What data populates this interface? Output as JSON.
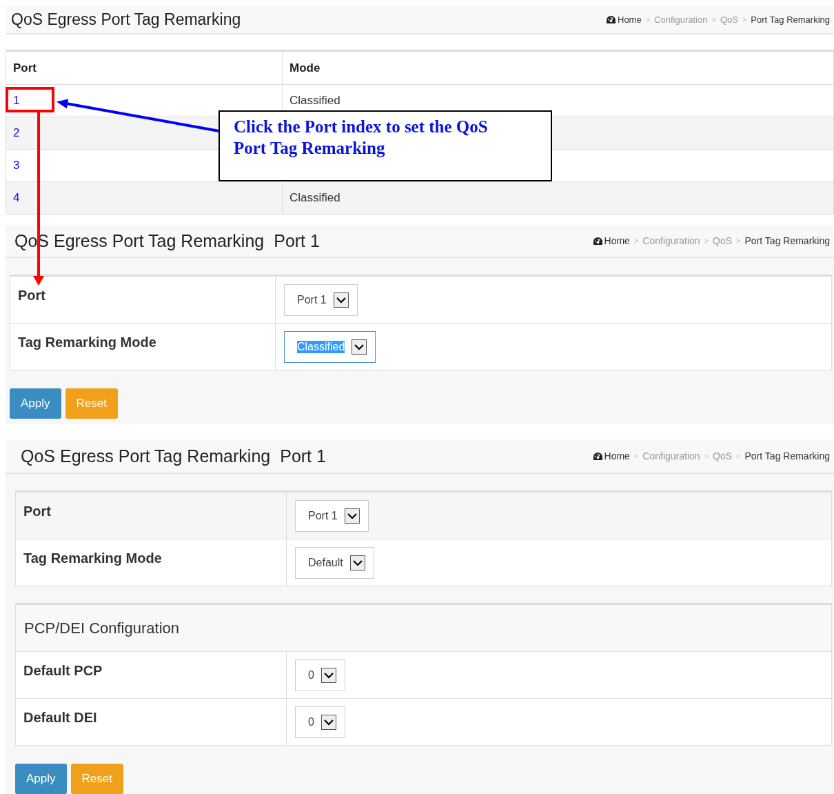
{
  "panels": [
    {
      "kind": "list",
      "title": "QoS Egress Port Tag Remarking",
      "breadcrumb": [
        {
          "kind": "home",
          "label": "Home"
        },
        {
          "kind": "link",
          "label": "Configuration",
          "separator": ">"
        },
        {
          "kind": "link",
          "label": "QoS",
          "separator": ">"
        },
        {
          "kind": "current",
          "label": "Port Tag Remarking",
          "separator": ">"
        }
      ],
      "table": {
        "columns": [
          "Port",
          "Mode"
        ],
        "rows": [
          {
            "port": "1",
            "mode": "Classified"
          },
          {
            "port": "2"
          },
          {
            "port": "3"
          },
          {
            "port": "4",
            "mode": "Classified"
          }
        ]
      }
    },
    {
      "kind": "form",
      "title": "QoS Egress Port Tag Remarking",
      "title_suffix": "Port 1",
      "breadcrumb": [
        {
          "kind": "home",
          "label": "Home"
        },
        {
          "kind": "link",
          "label": "Configuration",
          "separator": ">"
        },
        {
          "kind": "link",
          "label": "QoS",
          "separator": ">"
        },
        {
          "kind": "current",
          "label": "Port Tag Remarking",
          "separator": ">"
        }
      ],
      "sections": [
        {
          "rows": [
            {
              "label": "Port",
              "value": "Port 1",
              "focused": false
            },
            {
              "label": "Tag Remarking Mode",
              "value": "Classified",
              "focused": true
            }
          ]
        }
      ],
      "buttons": [
        {
          "kind": "primary",
          "label": "Apply"
        },
        {
          "kind": "warning",
          "label": "Reset"
        }
      ]
    },
    {
      "kind": "form",
      "title": "QoS Egress Port Tag Remarking",
      "title_suffix": "Port 1",
      "breadcrumb": [
        {
          "kind": "home",
          "label": "Home"
        },
        {
          "kind": "link",
          "label": "Configuration",
          "separator": ">"
        },
        {
          "kind": "link",
          "label": "QoS",
          "separator": ">"
        },
        {
          "kind": "current",
          "label": "Port Tag Remarking",
          "separator": ">"
        }
      ],
      "sections": [
        {
          "rows": [
            {
              "label": "Port",
              "value": "Port 1",
              "focused": false
            },
            {
              "label": "Tag Remarking Mode",
              "value": "Default",
              "focused": false
            }
          ]
        },
        {
          "heading": "PCP/DEI Configuration",
          "rows": [
            {
              "label": "Default PCP",
              "value": "0",
              "focused": false
            },
            {
              "label": "Default DEI",
              "value": "0",
              "focused": false
            }
          ]
        }
      ],
      "buttons": [
        {
          "kind": "primary",
          "label": "Apply"
        },
        {
          "kind": "warning",
          "label": "Reset"
        }
      ]
    }
  ],
  "annotation": {
    "text": "Click the Port index to set the QoS Port Tag Remarking"
  }
}
